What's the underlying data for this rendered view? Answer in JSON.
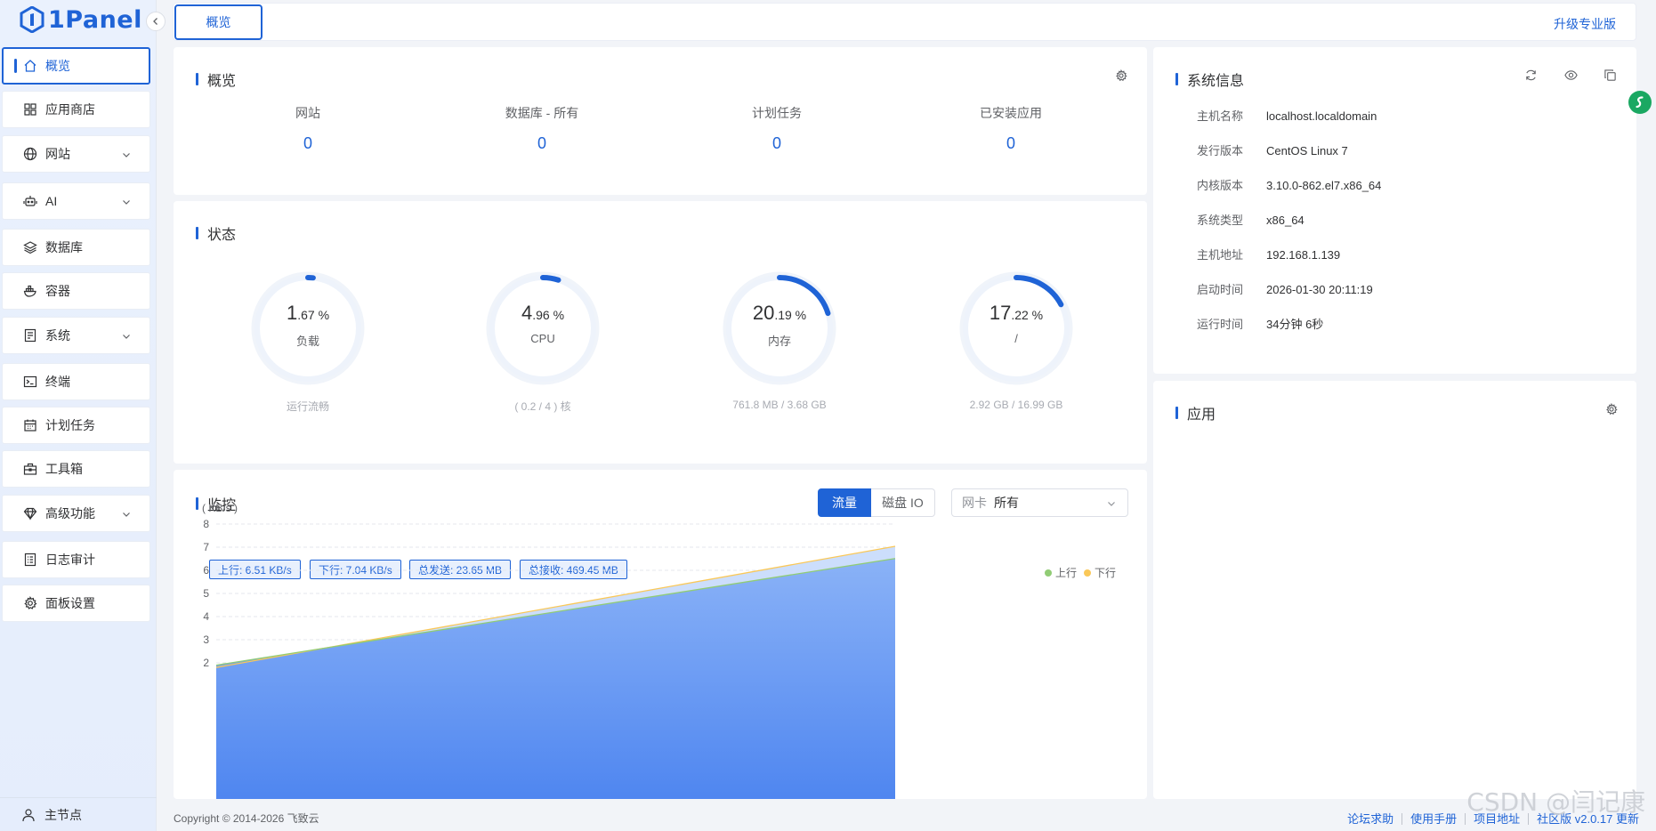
{
  "app": {
    "name": "1Panel"
  },
  "sidebar": {
    "items": [
      {
        "label": "概览",
        "icon": "home-icon"
      },
      {
        "label": "应用商店",
        "icon": "grid-icon"
      },
      {
        "label": "网站",
        "icon": "globe-icon"
      },
      {
        "label": "AI",
        "icon": "robot-icon"
      },
      {
        "label": "数据库",
        "icon": "layers-icon"
      },
      {
        "label": "容器",
        "icon": "docker-icon"
      },
      {
        "label": "系统",
        "icon": "server-icon"
      },
      {
        "label": "终端",
        "icon": "terminal-icon"
      },
      {
        "label": "计划任务",
        "icon": "calendar-icon"
      },
      {
        "label": "工具箱",
        "icon": "toolbox-icon"
      },
      {
        "label": "高级功能",
        "icon": "diamond-icon"
      },
      {
        "label": "日志审计",
        "icon": "log-icon"
      },
      {
        "label": "面板设置",
        "icon": "gear-icon"
      }
    ],
    "footer": "主节点"
  },
  "topbar": {
    "tab": "概览",
    "upgrade": "升级专业版"
  },
  "overview": {
    "title": "概览",
    "stats": [
      {
        "label": "网站",
        "value": "0"
      },
      {
        "label": "数据库 - 所有",
        "value": "0"
      },
      {
        "label": "计划任务",
        "value": "0"
      },
      {
        "label": "已安装应用",
        "value": "0"
      }
    ]
  },
  "status": {
    "title": "状态",
    "gauges": [
      {
        "int": "1",
        "dec": ".67 %",
        "name": "负载",
        "sub": "运行流畅",
        "percent": 1.67
      },
      {
        "int": "4",
        "dec": ".96 %",
        "name": "CPU",
        "sub": "( 0.2 / 4 ) 核",
        "percent": 4.96
      },
      {
        "int": "20",
        "dec": ".19 %",
        "name": "内存",
        "sub": "761.8 MB / 3.68 GB",
        "percent": 20.19
      },
      {
        "int": "17",
        "dec": ".22 %",
        "name": "/",
        "sub": "2.92 GB / 16.99 GB",
        "percent": 17.22
      }
    ]
  },
  "sysinfo": {
    "title": "系统信息",
    "rows": [
      {
        "key": "主机名称",
        "value": "localhost.localdomain"
      },
      {
        "key": "发行版本",
        "value": "CentOS Linux 7"
      },
      {
        "key": "内核版本",
        "value": "3.10.0-862.el7.x86_64"
      },
      {
        "key": "系统类型",
        "value": "x86_64"
      },
      {
        "key": "主机地址",
        "value": "192.168.1.139"
      },
      {
        "key": "启动时间",
        "value": "2026-01-30 20:11:19"
      },
      {
        "key": "运行时间",
        "value": "34分钟 6秒"
      }
    ]
  },
  "apps": {
    "title": "应用"
  },
  "monitor": {
    "title": "监控",
    "toggle": {
      "traffic": "流量",
      "disk": "磁盘 IO"
    },
    "nic": {
      "label": "网卡",
      "value": "所有"
    },
    "badges": [
      "上行: 6.51 KB/s",
      "下行: 7.04 KB/s",
      "总发送: 23.65 MB",
      "总接收: 469.45 MB"
    ],
    "legend": {
      "up": "上行",
      "down": "下行"
    }
  },
  "colors": {
    "accent": "#1f63d6",
    "up": "#91cc75",
    "down": "#fac858",
    "fill": "#5b8ff9"
  },
  "chart_data": {
    "type": "area",
    "unit_label": "( KB/s )",
    "yticks": [
      "8",
      "7",
      "6",
      "5",
      "4",
      "3",
      "2"
    ],
    "ylim": [
      1.6,
      8
    ],
    "grid": true,
    "legend_position": "top-right",
    "series": [
      {
        "name": "上行",
        "values": [
          1.9,
          6.51
        ]
      },
      {
        "name": "下行",
        "values": [
          1.8,
          7.04
        ]
      }
    ]
  },
  "footer": {
    "copyright": "Copyright © 2014-2026 飞致云",
    "links": [
      "论坛求助",
      "使用手册",
      "项目地址",
      "社区版 v2.0.17 更新"
    ]
  },
  "watermark": "CSDN @闫记康"
}
